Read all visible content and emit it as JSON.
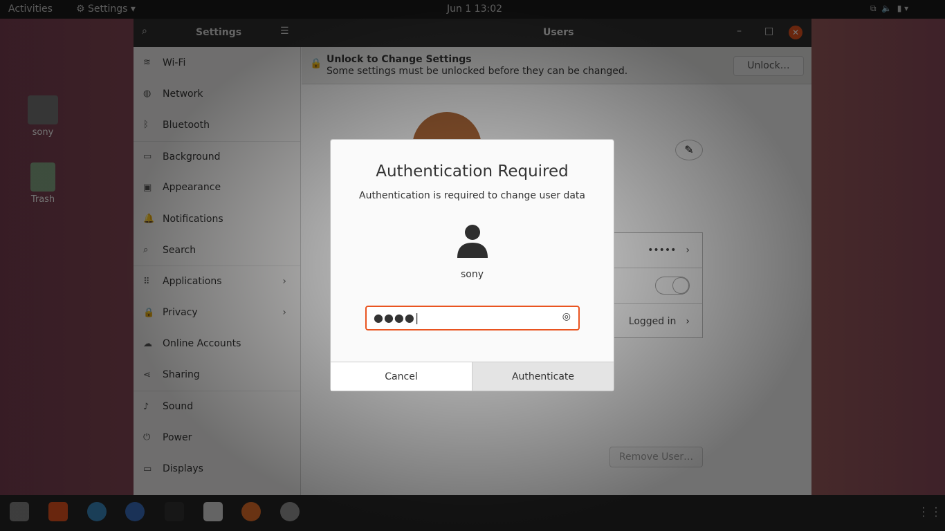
{
  "topbar": {
    "activities": "Activities",
    "app_menu": "Settings",
    "clock": "Jun 1  13:02"
  },
  "desktop": {
    "icons": [
      {
        "label": "sony",
        "icon": "home-folder-icon"
      },
      {
        "label": "Trash",
        "icon": "trash-icon"
      }
    ]
  },
  "window": {
    "sidebar_title": "Settings",
    "panel_title": "Users"
  },
  "sidebar": {
    "items": [
      {
        "label": "Wi-Fi",
        "icon": "wifi-icon"
      },
      {
        "label": "Network",
        "icon": "network-icon"
      },
      {
        "label": "Bluetooth",
        "icon": "bluetooth-icon"
      },
      {
        "label": "Background",
        "icon": "background-icon"
      },
      {
        "label": "Appearance",
        "icon": "appearance-icon"
      },
      {
        "label": "Notifications",
        "icon": "bell-icon"
      },
      {
        "label": "Search",
        "icon": "search-icon"
      },
      {
        "label": "Applications",
        "icon": "grid-icon",
        "chevron": true
      },
      {
        "label": "Privacy",
        "icon": "lock-icon",
        "chevron": true
      },
      {
        "label": "Online Accounts",
        "icon": "cloud-icon"
      },
      {
        "label": "Sharing",
        "icon": "share-icon"
      },
      {
        "label": "Sound",
        "icon": "music-icon"
      },
      {
        "label": "Power",
        "icon": "power-icon"
      },
      {
        "label": "Displays",
        "icon": "display-icon"
      }
    ]
  },
  "infobar": {
    "title": "Unlock to Change Settings",
    "subtitle": "Some settings must be unlocked before they can be changed.",
    "unlock": "Unlock…"
  },
  "users": {
    "password_mask": "•••••",
    "last_login": "Logged in",
    "remove_user": "Remove User…",
    "auto_login_on": true
  },
  "dialog": {
    "title": "Authentication Required",
    "message": "Authentication is required to change user data",
    "username": "sony",
    "password": "●●●●",
    "cancel": "Cancel",
    "authenticate": "Authenticate"
  },
  "accent": "#e95420"
}
